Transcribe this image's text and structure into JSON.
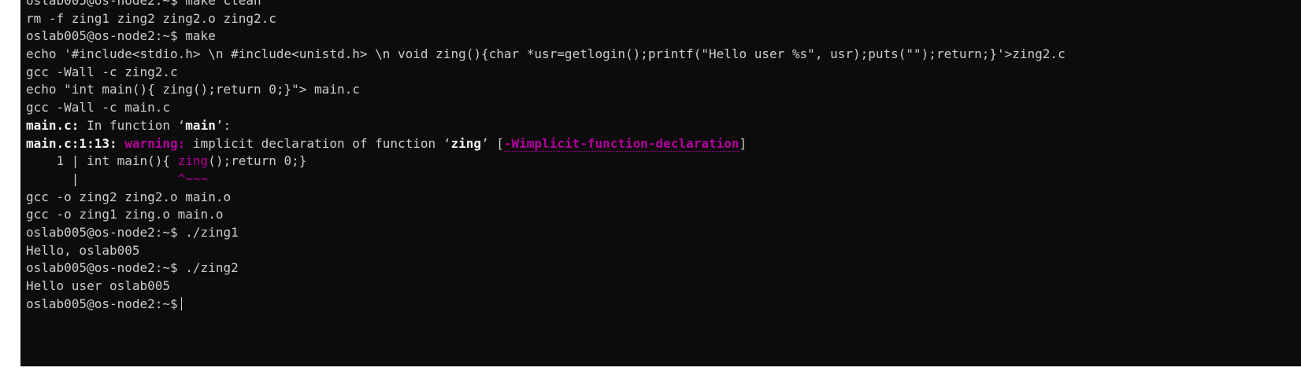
{
  "colors": {
    "background": "#0c0c0c",
    "foreground": "#cccccc",
    "warning": "#b4009e"
  },
  "terminal": {
    "prompt": "oslab005@os-node2:~$",
    "lines": {
      "l0_cmd": " make clean",
      "l1": "rm -f zing1 zing2 zing2.o zing2.c",
      "l2_cmd": " make",
      "l3": "echo '#include<stdio.h> \\n #include<unistd.h> \\n void zing(){char *usr=getlogin();printf(\"Hello user %s\", usr);puts(\"\");return;}'>zing2.c",
      "l4": "gcc -Wall -c zing2.c",
      "l5": "echo \"int main(){ zing();return 0;}\"> main.c",
      "l6": "gcc -Wall -c main.c",
      "l7_file": "main.c:",
      "l7_text": " In function ‘",
      "l7_fn": "main",
      "l7_end": "’:",
      "l8_loc": "main.c:1:13:",
      "l8_warn": "warning:",
      "l8_text": " implicit declaration of function ‘",
      "l8_fn": "zing",
      "l8_mid": "’ [",
      "l8_flag": "-Wimplicit-function-declaration",
      "l8_end": "]",
      "l9_num": "    1 | int main(){ ",
      "l9_zing": "zing",
      "l9_rest": "();return 0;}",
      "l10_bar": "      |",
      "l10_caret": "             ^~~~",
      "l11": "gcc -o zing2 zing2.o main.o",
      "l12": "gcc -o zing1 zing.o main.o",
      "l13_cmd": " ./zing1",
      "l14": "Hello, oslab005",
      "l15_cmd": " ./zing2",
      "l16": "Hello user oslab005"
    }
  }
}
